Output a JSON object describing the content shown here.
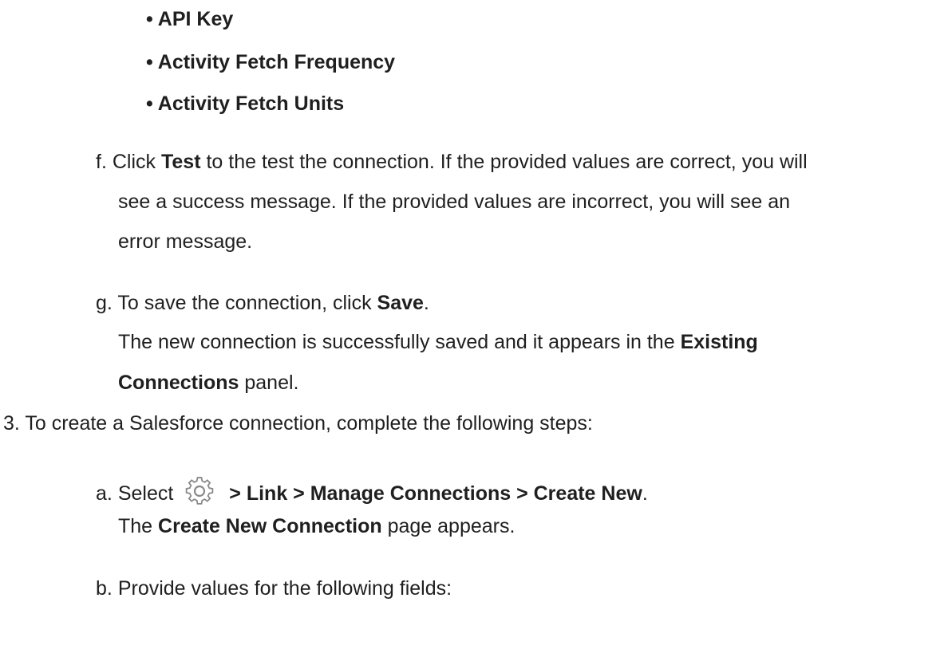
{
  "fields_list": [
    "• API Key",
    "• Activity Fetch Frequency",
    "• Activity Fetch Units"
  ],
  "step_f": {
    "marker": "f.",
    "line1_pre": "Click ",
    "line1_bold": "Test",
    "line1_post": " to the test the connection. If the provided values are correct, you will",
    "line2": "see a success message. If the provided values are incorrect, you will see an",
    "line3": "error message."
  },
  "step_g": {
    "marker": "g.",
    "line1_pre": "To save the connection, click ",
    "line1_bold": "Save",
    "line1_post": ".",
    "line2_pre": "The new connection is successfully saved and it appears in the ",
    "line2_bold": "Existing",
    "line3_bold": "Connections",
    "line3_post": " panel."
  },
  "step_3": {
    "marker": "3.",
    "text": "To create a Salesforce connection, complete the following steps:"
  },
  "step_a": {
    "marker": "a.",
    "pre": "Select",
    "icon": "gear-icon",
    "path": "> Link > Manage Connections > Create New",
    "post": ".",
    "line2_pre": "The ",
    "line2_bold": "Create New Connection",
    "line2_post": " page appears."
  },
  "step_b": {
    "marker": "b.",
    "text": "Provide values for the following fields:"
  },
  "colors": {
    "text": "#1f1f1f",
    "icon": "#8a8a8a"
  }
}
